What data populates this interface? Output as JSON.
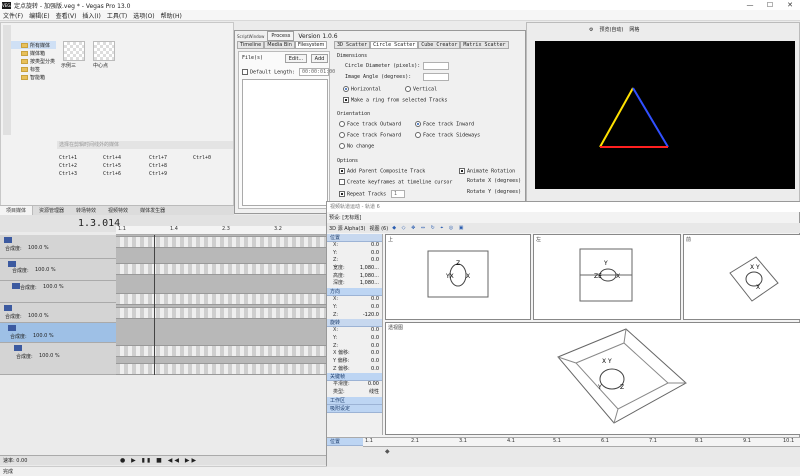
{
  "window": {
    "title": "定点旋转 - 加强版.veg * - Vegas Pro 13.0",
    "logo": "VEGAS"
  },
  "menu": [
    "文件(F)",
    "编辑(E)",
    "查看(V)",
    "插入(I)",
    "工具(T)",
    "选项(O)",
    "帮助(H)"
  ],
  "explorer": {
    "tree": [
      "所有媒体",
      "媒体箱",
      "按类型分类",
      "标签",
      "智能箱"
    ],
    "thumbs": [
      "示例三",
      "中心点"
    ],
    "hint": "选择在剪辑时间线外的媒体",
    "shortcuts": [
      "Ctrl+1",
      "Ctrl+4",
      "Ctrl+7",
      "Ctrl+0",
      "Ctrl+2",
      "Ctrl+5",
      "Ctrl+8",
      "Ctrl+3",
      "Ctrl+6",
      "Ctrl+9"
    ],
    "tabs": [
      "项目媒体",
      "资源管理器",
      "转场特效",
      "视频特效",
      "媒体发生器"
    ]
  },
  "script_window": {
    "logo": "ScriptWindow",
    "process_label": "Process",
    "version": "Version 1.0.6",
    "tabs_left": [
      "Timeline",
      "Media Bin",
      "Filesystem"
    ],
    "file_label": "File(s)",
    "edit_btn": "Edit...",
    "add_btn": "Add",
    "default_length": "Default Length:",
    "default_length_value": "00:00:01:00",
    "tabs_right": [
      "3D Scatter",
      "Circle Scatter",
      "Cube Creator",
      "Matrix Scatter"
    ],
    "dimensions": "Dimensions",
    "circle_diameter": "Circle Diameter (pixels):",
    "image_angle": "Image Angle (degrees):",
    "horizontal": "Horizontal",
    "vertical": "Vertical",
    "make_ring": "Make a ring from selected Tracks",
    "orientation": "Orientation",
    "face_outward": "Face track Outward",
    "face_inward": "Face track Inward",
    "face_forward": "Face track Forward",
    "face_sideways": "Face track Sideways",
    "no_change": "No change",
    "options": "Options",
    "add_parent": "Add Parent Composite Track",
    "animate_rotation": "Animate Rotation",
    "create_keyframes": "Create keyframes at timeline cursor",
    "rotate_x": "Rotate X (degrees)",
    "rotate_y": "Rotate Y (degrees)",
    "repeat_tracks": "Repeat Tracks",
    "repeat_value": "1"
  },
  "preview": {
    "toolbar_preset": "预览(自动)",
    "toolbar_grid": "网格"
  },
  "timeline": {
    "timecode": "1.3.014",
    "ruler": [
      "1.1",
      "1.4",
      "2.3",
      "3.2"
    ],
    "track_levels": [
      {
        "label": "合成度:",
        "value": "100.0 %"
      },
      {
        "label": "合成度:",
        "value": "100.0 %"
      },
      {
        "label": "合成度:",
        "value": "100.0 %"
      },
      {
        "label": "合成度:",
        "value": "100.0 %"
      },
      {
        "label": "合成度:",
        "value": "100.0 %"
      },
      {
        "label": "合成度:",
        "value": "100.0 %"
      }
    ],
    "rate": "速率: 0.00",
    "status": "完成"
  },
  "track_motion": {
    "title": "视频轨道运动 - 轨道 6",
    "preset_label": "预设:",
    "preset_value": "[无标题]",
    "mode": "3D 源 Alpha(3)",
    "view": "视图 (6)",
    "sections": {
      "position": "位置",
      "orientation": "方向",
      "rotation": "旋转",
      "keyframe": "关键帧",
      "workspace": "工作区",
      "snap": "吸附设定"
    },
    "position_props": [
      {
        "k": "X:",
        "v": "0.0"
      },
      {
        "k": "Y:",
        "v": "0.0"
      },
      {
        "k": "Z:",
        "v": "0.0"
      },
      {
        "k": "宽度:",
        "v": "1,080..."
      },
      {
        "k": "高度:",
        "v": "1,080..."
      },
      {
        "k": "深度:",
        "v": "1,080..."
      }
    ],
    "orient_props": [
      {
        "k": "X:",
        "v": "0.0"
      },
      {
        "k": "Y:",
        "v": "0.0"
      },
      {
        "k": "Z:",
        "v": "-120.0"
      }
    ],
    "rot_props": [
      {
        "k": "X:",
        "v": "0.0"
      },
      {
        "k": "Y:",
        "v": "0.0"
      },
      {
        "k": "Z:",
        "v": "0.0"
      },
      {
        "k": "X 偏移:",
        "v": "0.0"
      },
      {
        "k": "Y 偏移:",
        "v": "0.0"
      },
      {
        "k": "Z 偏移:",
        "v": "0.0"
      }
    ],
    "key_props": [
      {
        "k": "平滑度:",
        "v": "0.00"
      },
      {
        "k": "类型:",
        "v": "线性"
      }
    ],
    "views": {
      "top": "上",
      "left": "左",
      "front": "前",
      "persp": "透视图"
    },
    "ruler_label": "位置",
    "ruler": [
      "1.1",
      "2.1",
      "3.1",
      "4.1",
      "5.1",
      "6.1",
      "7.1",
      "8.1",
      "9.1",
      "10.1"
    ]
  },
  "colors": {
    "accent": "#2a5db0",
    "tri_yellow": "#ffe100",
    "tri_blue": "#3050ff",
    "tri_red": "#ff2020"
  }
}
